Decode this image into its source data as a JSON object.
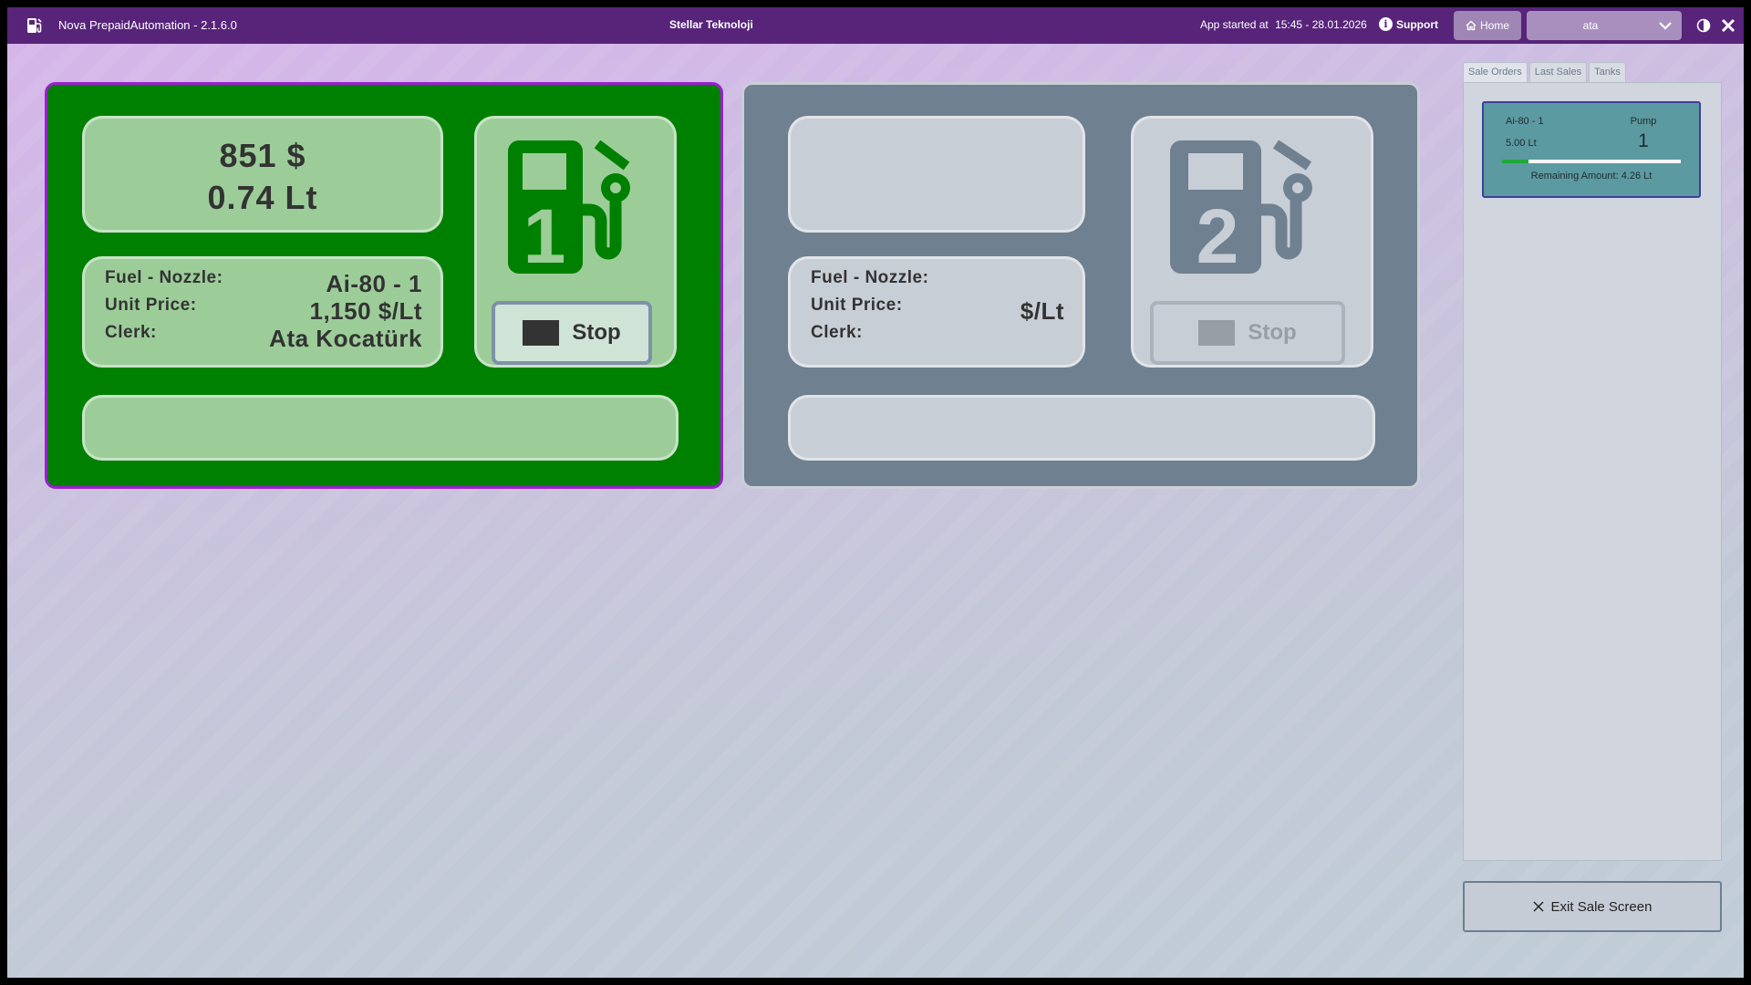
{
  "titlebar": {
    "app_title": "Nova PrepaidAutomation - 2.1.6.0",
    "company": "Stellar Teknoloji",
    "started_label": "App started at",
    "started_value": "15:45 - 28.01.2026",
    "support_label": "Support",
    "home_label": "Home",
    "user_value": "ata"
  },
  "pumps": [
    {
      "number": "1",
      "amount": "851 $",
      "volume": "0.74 Lt",
      "fuel_nozzle_label": "Fuel - Nozzle:",
      "fuel_nozzle_value": "Ai-80 - 1",
      "unit_price_label": "Unit Price:",
      "unit_price_value": "1,150 $/Lt",
      "clerk_label": "Clerk:",
      "clerk_value": "Ata Kocatürk",
      "stop_label": "Stop",
      "status_color": "#008000"
    },
    {
      "number": "2",
      "amount": "",
      "volume": "",
      "fuel_nozzle_label": "Fuel - Nozzle:",
      "fuel_nozzle_value": "",
      "unit_price_label": "Unit Price:",
      "unit_price_value": "$/Lt",
      "clerk_label": "Clerk:",
      "clerk_value": "",
      "stop_label": "Stop",
      "status_color": "#6f8090"
    }
  ],
  "side_tabs": [
    "Sale Orders",
    "Last Sales",
    "Tanks"
  ],
  "orders": [
    {
      "fuel": "Ai-80 - 1",
      "quantity": "5.00 Lt",
      "pump_label": "Pump",
      "pump_number": "1",
      "progress": 0.148,
      "remaining": "Remaining Amount: 4.26 Lt"
    }
  ],
  "exit_label": "Exit Sale Screen",
  "colors": {
    "titlebar": "#57247a",
    "active_pump": "#008000",
    "idle_pump": "#6f8090",
    "selected_border": "#9b1fd1",
    "progress": "#1fa83b"
  }
}
